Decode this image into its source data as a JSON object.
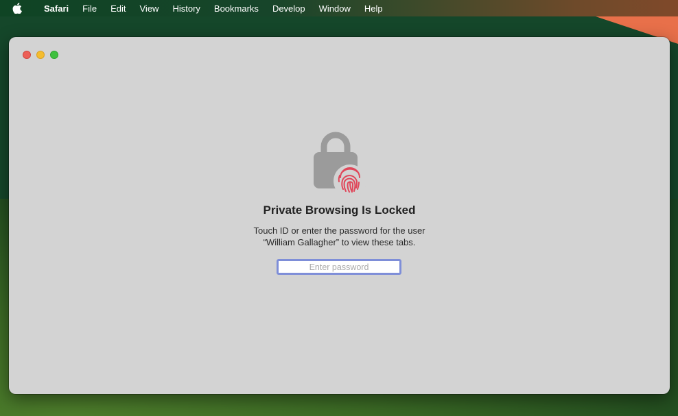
{
  "menubar": {
    "apple_icon": "apple-logo-icon",
    "items": [
      "Safari",
      "File",
      "Edit",
      "View",
      "History",
      "Bookmarks",
      "Develop",
      "Window",
      "Help"
    ]
  },
  "window": {
    "traffic_lights": {
      "close": "#ec5f57",
      "minimize": "#f5bd2f",
      "maximize": "#3fc03f"
    },
    "icon": "lock-with-touch-id-icon",
    "title": "Private Browsing Is Locked",
    "description_line1": "Touch ID or enter the password for the user",
    "description_line2": "“William Gallagher” to view these tabs.",
    "password_field": {
      "value": "",
      "placeholder": "Enter password"
    },
    "colors": {
      "fingerprint": "#e0475a",
      "lock": "#9b9b9b",
      "focus_ring": "#7e8ed8"
    }
  }
}
